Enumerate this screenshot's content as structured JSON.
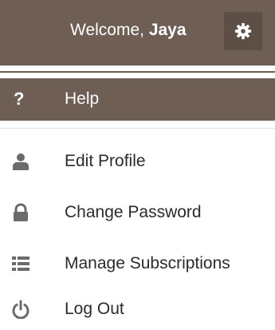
{
  "header": {
    "welcome_prefix": "Welcome, ",
    "username": "Jaya",
    "settings_icon": "gear-icon"
  },
  "menu": {
    "help": {
      "icon": "question-icon",
      "glyph": "?",
      "label": "Help"
    },
    "items": [
      {
        "icon": "user-icon",
        "label": "Edit Profile"
      },
      {
        "icon": "lock-icon",
        "label": "Change Password"
      },
      {
        "icon": "list-icon",
        "label": "Manage Subscriptions"
      },
      {
        "icon": "power-icon",
        "label": "Log Out"
      }
    ]
  },
  "colors": {
    "header_bg": "#6e5e54",
    "gear_bg": "#5e4f46",
    "icon_color": "#6b6b6b",
    "text_color": "#2b2b2b"
  }
}
